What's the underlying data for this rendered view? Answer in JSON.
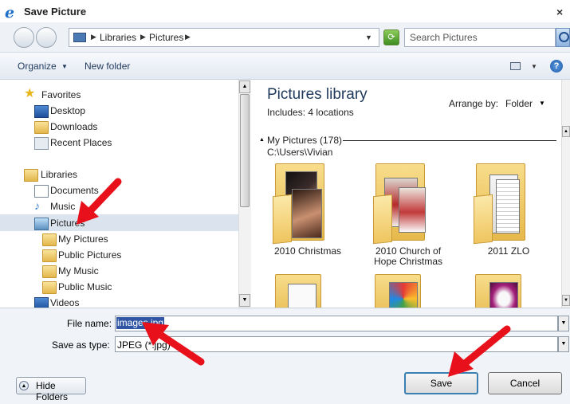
{
  "window": {
    "title": "Save Picture",
    "close_glyph": "×"
  },
  "address": {
    "breadcrumb": [
      "Libraries",
      "Pictures"
    ],
    "search_placeholder": "Search Pictures"
  },
  "toolbar": {
    "organize": "Organize",
    "new_folder": "New folder",
    "help": "?"
  },
  "nav": {
    "items": [
      {
        "label": "Favorites",
        "icon": "star-icon"
      },
      {
        "label": "Desktop",
        "icon": "desktop-icon"
      },
      {
        "label": "Downloads",
        "icon": "downloads-icon"
      },
      {
        "label": "Recent Places",
        "icon": "recent-places-icon"
      },
      {
        "label": "Libraries",
        "icon": "libraries-icon"
      },
      {
        "label": "Documents",
        "icon": "documents-icon"
      },
      {
        "label": "Music",
        "icon": "music-icon"
      },
      {
        "label": "Pictures",
        "icon": "pictures-icon",
        "selected": true
      },
      {
        "label": "My Pictures",
        "icon": "folder-icon"
      },
      {
        "label": "Public Pictures",
        "icon": "folder-icon"
      },
      {
        "label": "My Music",
        "icon": "folder-icon"
      },
      {
        "label": "Public Music",
        "icon": "folder-icon"
      },
      {
        "label": "Videos",
        "icon": "videos-icon"
      }
    ]
  },
  "content": {
    "title": "Pictures library",
    "includes": "Includes:",
    "locations": "4 locations",
    "arrange_label": "Arrange by:",
    "arrange_value": "Folder",
    "group_title": "My Pictures (178)",
    "group_path": "C:\\Users\\Vivian",
    "folders": [
      {
        "label": "2010 Christmas"
      },
      {
        "label": "2010 Church of Hope Christmas"
      },
      {
        "label": "2011 ZLO"
      }
    ]
  },
  "bottom": {
    "file_name_label": "File name:",
    "file_name_value": "images.jpg",
    "save_type_label": "Save as type:",
    "save_type_value": "JPEG (*.jpg)",
    "hide_folders": "Hide Folders",
    "save": "Save",
    "cancel": "Cancel"
  },
  "colors": {
    "annotation_arrow": "#e8101a",
    "selection": "#dbe4ee",
    "text_selection": "#2f55a4"
  }
}
